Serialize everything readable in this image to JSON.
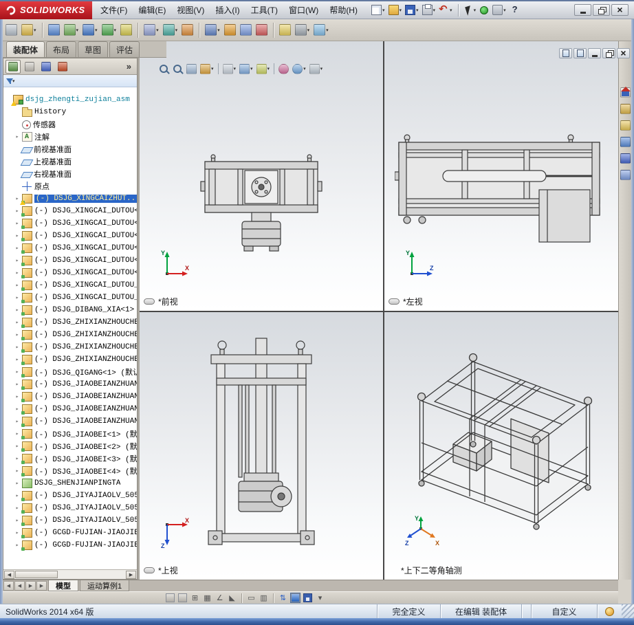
{
  "titlebar": {
    "logo_text": "SOLIDWORKS",
    "menus": [
      "文件(F)",
      "编辑(E)",
      "视图(V)",
      "插入(I)",
      "工具(T)",
      "窗口(W)",
      "帮助(H)"
    ],
    "quick_buttons": [
      {
        "name": "new-document-button",
        "caret": true
      },
      {
        "name": "open-button",
        "caret": true
      },
      {
        "name": "save-button",
        "caret": true
      },
      {
        "name": "print-button",
        "caret": true
      },
      {
        "name": "undo-button",
        "caret": true
      },
      {
        "name": "select-button",
        "caret": true
      },
      {
        "name": "macro-record-button",
        "caret": false
      },
      {
        "name": "options-button",
        "caret": true
      },
      {
        "name": "help-button",
        "caret": false
      }
    ],
    "window_buttons": [
      {
        "name": "minimize-window-button"
      },
      {
        "name": "restore-window-button"
      },
      {
        "name": "close-window-button"
      }
    ]
  },
  "toolbar": {
    "buttons": [
      {
        "name": "edit-component",
        "color": "#b9c2cc"
      },
      {
        "name": "insert-components",
        "color": "#e3bf4e",
        "caret": true
      },
      {
        "name": "mate",
        "color": "#5b8dd9"
      },
      {
        "name": "linear-component-pattern",
        "color": "#79b661",
        "caret": true
      },
      {
        "name": "smart-fasteners",
        "color": "#4a7fd0",
        "caret": true
      },
      {
        "name": "move-component",
        "color": "#55b055",
        "caret": true
      },
      {
        "name": "show-hidden-components",
        "color": "#d9cd52"
      },
      {
        "name": "assembly-features",
        "color": "#98a6d6",
        "caret": true
      },
      {
        "name": "reference-geometry",
        "color": "#4fb0a6",
        "caret": true
      },
      {
        "name": "new-motion-study",
        "color": "#e0913f"
      },
      {
        "name": "bill-of-materials",
        "color": "#6687c7",
        "caret": true
      },
      {
        "name": "exploded-view",
        "color": "#e8a031"
      },
      {
        "name": "explode-line-sketch",
        "color": "#7f9fe0"
      },
      {
        "name": "interference-detection",
        "color": "#d86161"
      },
      {
        "name": "instant-3d",
        "color": "#e8d05f"
      },
      {
        "name": "external-references",
        "color": "#a3abb3",
        "caret": true
      },
      {
        "name": "take-snapshot",
        "color": "#86bfe7",
        "caret": true
      }
    ]
  },
  "command_tabs": [
    {
      "label": "装配体",
      "active": true
    },
    {
      "label": "布局",
      "active": false
    },
    {
      "label": "草图",
      "active": false
    },
    {
      "label": "评估",
      "active": false
    }
  ],
  "feature_panel": {
    "expand_label": "»",
    "manager_tabs": [
      {
        "name": "featuremanager-tab",
        "color": "#63a14e",
        "active": true
      },
      {
        "name": "propertymanager-tab",
        "color": "#c8c4bc",
        "active": false
      },
      {
        "name": "configurationmanager-tab",
        "color": "#4a6ad0",
        "active": false
      },
      {
        "name": "displaymanager-tab",
        "color": "#d0502a",
        "active": false
      }
    ],
    "tree": [
      {
        "icon": "assembly",
        "label": "dsjg_zhengti_zujian_asm",
        "root": true,
        "warning": true
      },
      {
        "icon": "history",
        "label": "History"
      },
      {
        "icon": "sensor",
        "label": "传感器"
      },
      {
        "icon": "annotation",
        "label": "注解",
        "expand": true
      },
      {
        "icon": "plane",
        "label": "前视基准面"
      },
      {
        "icon": "plane",
        "label": "上视基准面"
      },
      {
        "icon": "plane",
        "label": "右视基准面"
      },
      {
        "icon": "origin",
        "label": "原点"
      },
      {
        "icon": "component",
        "label": "(-) DSJG_XINGCAIZHUT...",
        "selected": true,
        "warning": true,
        "expand": true
      },
      {
        "icon": "component",
        "label": "(-) DSJG_XINGCAI_DUTOU<",
        "expand": true
      },
      {
        "icon": "component",
        "label": "(-) DSJG_XINGCAI_DUTOU<",
        "expand": true
      },
      {
        "icon": "component",
        "label": "(-) DSJG_XINGCAI_DUTOU<",
        "expand": true
      },
      {
        "icon": "component",
        "label": "(-) DSJG_XINGCAI_DUTOU<",
        "expand": true
      },
      {
        "icon": "component",
        "label": "(-) DSJG_XINGCAI_DUTOU<",
        "expand": true
      },
      {
        "icon": "component",
        "label": "(-) DSJG_XINGCAI_DUTOU<",
        "expand": true
      },
      {
        "icon": "component",
        "label": "(-) DSJG_XINGCAI_DUTOU_",
        "expand": true
      },
      {
        "icon": "component",
        "label": "(-) DSJG_XINGCAI_DUTOU_",
        "expand": true
      },
      {
        "icon": "component",
        "label": "(-) DSJG_DIBANG_XIA<1>",
        "expand": true
      },
      {
        "icon": "component",
        "label": "(-) DSJG_ZHIXIANZHOUCHE",
        "expand": true
      },
      {
        "icon": "component",
        "label": "(-) DSJG_ZHIXIANZHOUCHE",
        "expand": true
      },
      {
        "icon": "component",
        "label": "(-) DSJG_ZHIXIANZHOUCHE",
        "expand": true
      },
      {
        "icon": "component",
        "label": "(-) DSJG_ZHIXIANZHOUCHE",
        "expand": true
      },
      {
        "icon": "component",
        "label": "(-) DSJG_QIGANG<1> (默认",
        "expand": true
      },
      {
        "icon": "component",
        "label": "(-) DSJG_JIAOBEIANZHUAN",
        "expand": true
      },
      {
        "icon": "component",
        "label": "(-) DSJG_JIAOBEIANZHUAN",
        "expand": true
      },
      {
        "icon": "component",
        "label": "(-) DSJG_JIAOBEIANZHUAN",
        "expand": true
      },
      {
        "icon": "component",
        "label": "(-) DSJG_JIAOBEIANZHUAN",
        "expand": true
      },
      {
        "icon": "component",
        "label": "(-) DSJG_JIAOBEI<1> (默认",
        "expand": true
      },
      {
        "icon": "component",
        "label": "(-) DSJG_JIAOBEI<2> (默认",
        "expand": true
      },
      {
        "icon": "component",
        "label": "(-) DSJG_JIAOBEI<3> (默认",
        "expand": true
      },
      {
        "icon": "component",
        "label": "(-) DSJG_JIAOBEI<4> (默认",
        "expand": true
      },
      {
        "icon": "component-fixed",
        "label": "DSJG_SHENJIANPINGTA",
        "expand": true
      },
      {
        "icon": "component",
        "label": "(-) DSJG_JIYAJIAOLV_505",
        "expand": true
      },
      {
        "icon": "component",
        "label": "(-) DSJG_JIYAJIAOLV_505",
        "expand": true
      },
      {
        "icon": "component",
        "label": "(-) DSJG_JIYAJIAOLV_505",
        "expand": true
      },
      {
        "icon": "component",
        "label": "(-) GCGD-FUJIAN-JIAOJIE",
        "expand": true
      },
      {
        "icon": "component",
        "label": "(-) GCGD-FUJIAN-JIAOJIE",
        "expand": true
      }
    ]
  },
  "viewport_toolbar": {
    "buttons": [
      {
        "name": "zoom-to-fit",
        "kind": "zoom"
      },
      {
        "name": "zoom-to-area",
        "kind": "zoom"
      },
      {
        "name": "previous-view",
        "kind": "box",
        "color": "#9db6d2"
      },
      {
        "name": "section-view",
        "kind": "box",
        "color": "#d9a23f",
        "caret": true
      },
      {
        "name": "view-orientation",
        "kind": "box",
        "color": "#c3ccd6",
        "caret": true
      },
      {
        "name": "display-style",
        "kind": "box",
        "color": "#7fa9d9",
        "caret": true
      },
      {
        "name": "hide-show-items",
        "kind": "box",
        "color": "#c7cf66",
        "caret": true
      },
      {
        "name": "edit-appearance",
        "kind": "ball",
        "color": "#cf6f9e"
      },
      {
        "name": "apply-scene",
        "kind": "ball",
        "color": "#6fa3d8",
        "caret": true
      },
      {
        "name": "view-settings",
        "kind": "box",
        "color": "#b9c4ce",
        "caret": true
      }
    ]
  },
  "document_controls": [
    {
      "name": "previous-window-button"
    },
    {
      "name": "next-window-button"
    },
    {
      "name": "minimize-document-button"
    },
    {
      "name": "restore-document-button"
    },
    {
      "name": "close-document-button"
    }
  ],
  "task_pane": [
    {
      "name": "solidworks-resources",
      "color": "#e8e4de"
    },
    {
      "name": "design-library",
      "color": "#e0b84e"
    },
    {
      "name": "file-explorer",
      "color": "#e8c85a"
    },
    {
      "name": "view-palette",
      "color": "#5b8dd9"
    },
    {
      "name": "appearances-scenes",
      "color": "#4a6ad0"
    },
    {
      "name": "custom-properties",
      "color": "#7f9fe0"
    }
  ],
  "viewports": [
    {
      "label": "*前视",
      "axes": [
        "Y",
        "X"
      ]
    },
    {
      "label": "*左视",
      "axes": [
        "Y",
        "Z"
      ]
    },
    {
      "label": "*上视",
      "axes": [
        "X",
        "Z"
      ]
    },
    {
      "label": "*上下二等角轴测",
      "axes": [
        "Y",
        "X",
        "Z"
      ]
    }
  ],
  "bottom": {
    "nav_buttons": [
      {
        "name": "scroll-first-button",
        "glyph": "◀"
      },
      {
        "name": "scroll-prev-button",
        "glyph": "◀"
      },
      {
        "name": "scroll-next-button",
        "glyph": "▶"
      },
      {
        "name": "scroll-last-button",
        "glyph": "▶"
      }
    ],
    "tabs": [
      {
        "label": "模型",
        "active": true
      },
      {
        "label": "运动算例1",
        "active": false
      }
    ],
    "toolbar": [
      {
        "name": "measure",
        "type": "box",
        "color": "#c9c5bd"
      },
      {
        "name": "mass-properties",
        "type": "box",
        "color": "#c9c5bd"
      },
      {
        "name": "grid",
        "glyph": "⊞"
      },
      {
        "name": "grid-fine",
        "glyph": "▦"
      },
      {
        "name": "angle-snap",
        "glyph": "∠"
      },
      {
        "name": "angle-alt",
        "glyph": "◣"
      },
      {
        "sep": true
      },
      {
        "name": "rectangle-view",
        "glyph": "▭"
      },
      {
        "name": "split-columns",
        "glyph": "▥"
      },
      {
        "sep": true
      },
      {
        "name": "tile-windows",
        "glyph": "⇅",
        "color": "#2b5fc4"
      },
      {
        "name": "viewport-layout",
        "type": "box",
        "color": "#2b6fd4",
        "pressed": true
      },
      {
        "name": "save-view",
        "type": "floppy"
      },
      {
        "name": "more-options",
        "glyph": "▾"
      }
    ]
  },
  "statusbar": {
    "app_version": "SolidWorks 2014 x64 版",
    "definition_status": "完全定义",
    "edit_status": "在编辑 装配体",
    "custom_label": "自定义"
  }
}
